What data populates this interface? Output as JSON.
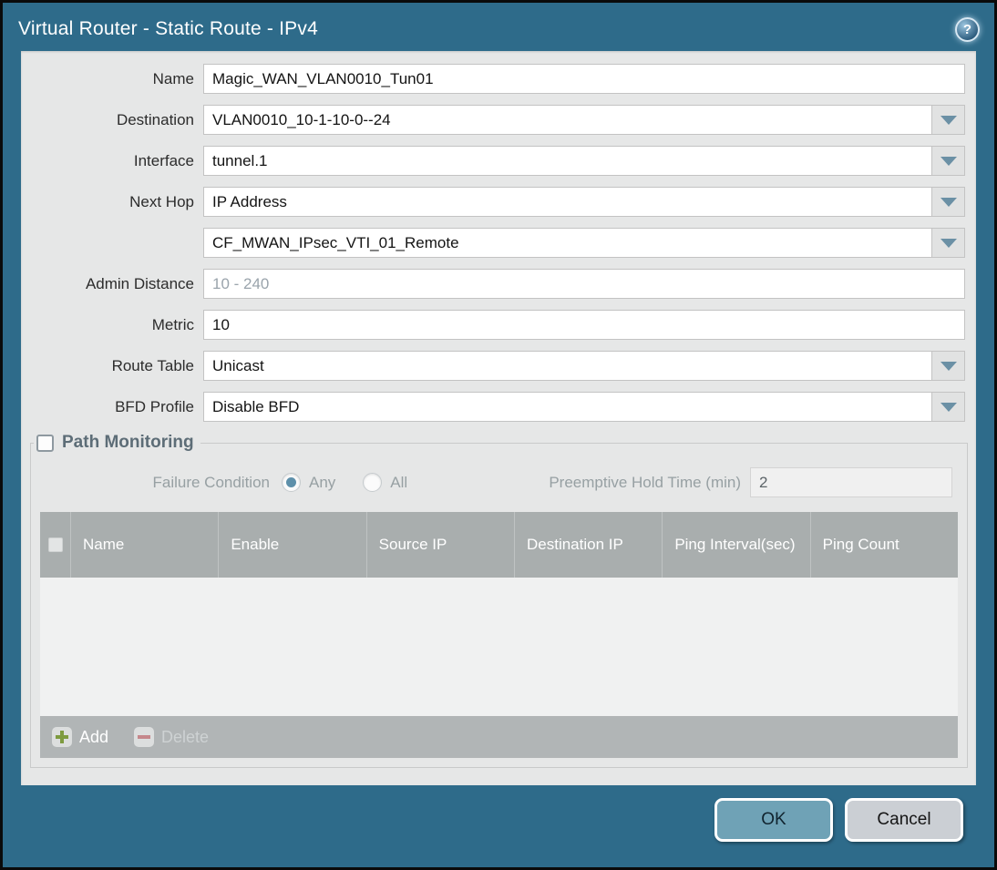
{
  "dialog": {
    "title": "Virtual Router - Static Route - IPv4",
    "help_glyph": "?"
  },
  "form": {
    "name": {
      "label": "Name",
      "value": "Magic_WAN_VLAN0010_Tun01"
    },
    "destination": {
      "label": "Destination",
      "value": "VLAN0010_10-1-10-0--24"
    },
    "interface": {
      "label": "Interface",
      "value": "tunnel.1"
    },
    "next_hop": {
      "label": "Next Hop",
      "value": "IP Address",
      "address_value": "CF_MWAN_IPsec_VTI_01_Remote"
    },
    "admin_distance": {
      "label": "Admin Distance",
      "value": "",
      "placeholder": "10 - 240"
    },
    "metric": {
      "label": "Metric",
      "value": "10"
    },
    "route_table": {
      "label": "Route Table",
      "value": "Unicast"
    },
    "bfd_profile": {
      "label": "BFD Profile",
      "value": "Disable BFD"
    }
  },
  "path_monitoring": {
    "title": "Path Monitoring",
    "checked": false,
    "failure_condition_label": "Failure Condition",
    "options": [
      {
        "label": "Any",
        "selected": true
      },
      {
        "label": "All",
        "selected": false
      }
    ],
    "preemptive_label": "Preemptive Hold Time (min)",
    "preemptive_value": "2",
    "table_headers": [
      "Name",
      "Enable",
      "Source IP",
      "Destination IP",
      "Ping Interval(sec)",
      "Ping Count"
    ],
    "rows": [],
    "add_label": "Add",
    "delete_label": "Delete"
  },
  "footer": {
    "ok_label": "OK",
    "cancel_label": "Cancel"
  },
  "colors": {
    "frame_teal": "#2e6b8a",
    "content_bg": "#e6e7e7",
    "table_header_bg": "#a9aeae",
    "table_footer_bg": "#b1b5b6",
    "ok_button_bg": "#6fa2b6",
    "cancel_button_bg": "#cbcfd4",
    "dropdown_arrow": "#6b90a5",
    "add_icon_green": "#7e9b40",
    "delete_icon_red": "#c5878b"
  }
}
